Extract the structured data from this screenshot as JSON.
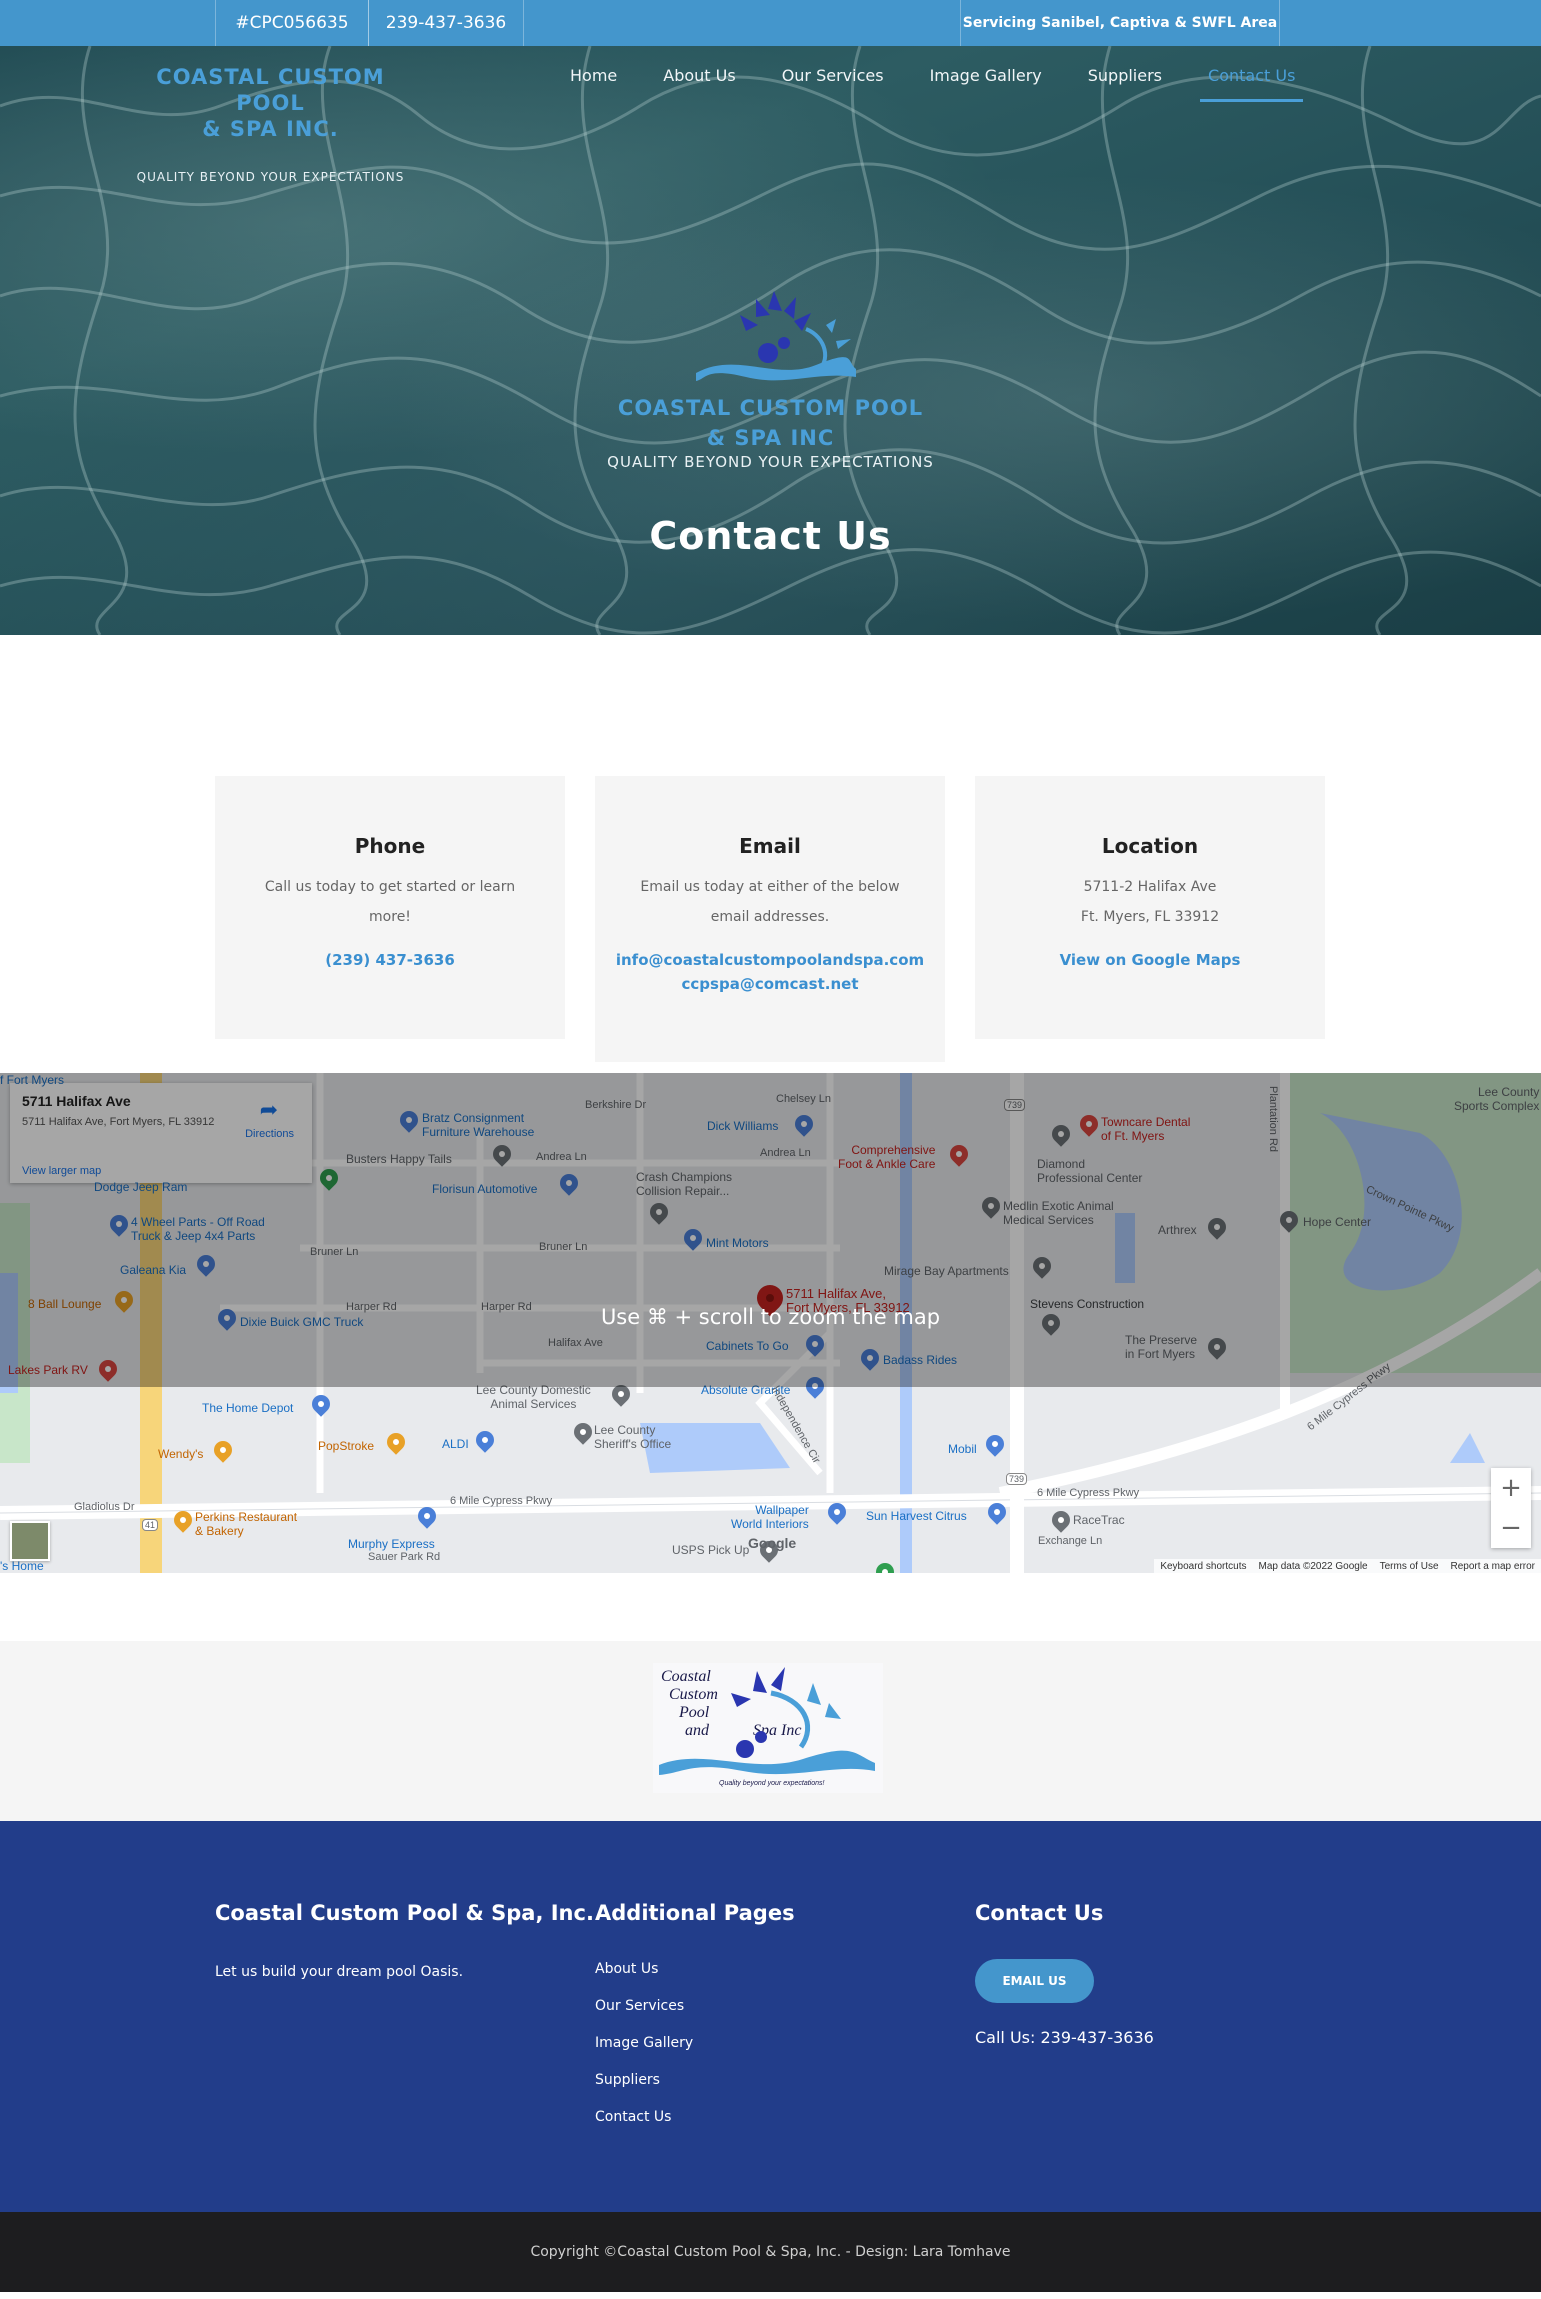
{
  "topbar": {
    "license": "#CPC056635",
    "phone": "239-437-3636",
    "service_area": "Servicing Sanibel, Captiva & SWFL Area"
  },
  "brand": {
    "name_line1": "COASTAL CUSTOM POOL",
    "name_line2": "& SPA INC.",
    "tagline": "QUALITY BEYOND YOUR EXPECTATIONS"
  },
  "nav": {
    "items": [
      {
        "label": "Home"
      },
      {
        "label": "About Us"
      },
      {
        "label": "Our Services"
      },
      {
        "label": "Image Gallery"
      },
      {
        "label": "Suppliers"
      },
      {
        "label": "Contact Us",
        "active": true
      }
    ]
  },
  "hero": {
    "logo_line1": "COASTAL CUSTOM POOL",
    "logo_line2": "& SPA INC",
    "logo_tagline": "QUALITY BEYOND YOUR EXPECTATIONS",
    "title": "Contact Us"
  },
  "cards": {
    "phone": {
      "title": "Phone",
      "text": "Call us today to get started or learn more!",
      "link": "(239) 437-3636"
    },
    "email": {
      "title": "Email",
      "text": "Email us today at either of the below email addresses.",
      "link1": "info@coastalcustompoolandspa.com",
      "link2": "ccpspa@comcast.net"
    },
    "location": {
      "title": "Location",
      "line1": "5711-2 Halifax Ave",
      "line2": "Ft. Myers, FL 33912",
      "link": "View on Google Maps"
    }
  },
  "map": {
    "zoom_hint": "Use ⌘ + scroll to zoom the map",
    "infobox": {
      "title": "5711 Halifax Ave",
      "address": "5711 Halifax Ave, Fort Myers, FL 33912",
      "directions": "Directions",
      "view_larger": "View larger map"
    },
    "marker_label_line1": "5711 Halifax Ave,",
    "marker_label_line2": "Fort Myers, FL 33912",
    "places": {
      "bratz": "Bratz Consignment",
      "bratz2": "Furniture Warehouse",
      "dick": "Dick Williams",
      "comp1": "Comprehensive",
      "comp2": "Foot & Ankle Care",
      "town1": "Towncare Dental",
      "town2": "of Ft. Myers",
      "lee1": "Lee County",
      "lee2": "Sports Complex",
      "busters": "Busters Happy Tails",
      "dodge": "Dodge Jeep Ram",
      "florisun": "Florisun Automotive",
      "crash1": "Crash Champions",
      "crash2": "Collision Repair...",
      "diamond1": "Diamond",
      "diamond2": "Professional Center",
      "medlin1": "Medlin Exotic Animal",
      "medlin2": "Medical Services",
      "arthrex": "Arthrex",
      "hope": "Hope Center",
      "wheel1": "4 Wheel Parts - Off Road",
      "wheel2": "Truck & Jeep 4x4 Parts",
      "mint": "Mint Motors",
      "galeana": "Galeana Kia",
      "mirage": "Mirage Bay Apartments",
      "stevens": "Stevens Construction",
      "ball": "8 Ball Lounge",
      "dixie": "Dixie Buick GMC Truck",
      "cabinets": "Cabinets To Go",
      "badass": "Badass Rides",
      "preserve1": "The Preserve",
      "preserve2": "in Fort Myers",
      "lakes": "Lakes Park RV",
      "leedom1": "Lee County Domestic",
      "leedom2": "Animal Services",
      "absolute": "Absolute Granite",
      "homedepot": "The Home Depot",
      "sheriff1": "Lee County",
      "sheriff2": "Sheriff's Office",
      "wendys": "Wendy's",
      "popstroke": "PopStroke",
      "aldi": "ALDI",
      "mobil": "Mobil",
      "perkins1": "Perkins Restaurant",
      "perkins2": "& Bakery",
      "murphy": "Murphy Express",
      "wallpaper1": "Wallpaper",
      "wallpaper2": "World Interiors",
      "sunharvest": "Sun Harvest Citrus",
      "racetrac": "RaceTrac",
      "usps": "USPS Pick Up",
      "road_andrea1": "Andrea Ln",
      "road_andrea2": "Andrea Ln",
      "road_bruner1": "Bruner Ln",
      "road_bruner2": "Bruner Ln",
      "road_harper1": "Harper Rd",
      "road_harper2": "Harper Rd",
      "road_halifax": "Halifax Ave",
      "road_chelsey": "Chelsey Ln",
      "road_berkshire": "Berkshire Dr",
      "road_gladiolus": "Gladiolus Dr",
      "road_sixmile1": "6 Mile Cypress Pkwy",
      "road_sixmile2": "6 Mile Cypress Pkwy",
      "road_sixmile3": "6 Mile Cypress Pkwy",
      "road_sauer": "Sauer Park Rd",
      "road_exchange": "Exchange Ln",
      "road_crown": "Crown Pointe Pkwy",
      "road_indep": "Independence Cir",
      "road_plant": "Plantation Rd",
      "fort_myers": "f Fort Myers",
      "home_partial": "'s Home",
      "shield_739a": "739",
      "shield_739b": "739",
      "shield_41": "41",
      "google": "Google"
    },
    "attribution": [
      "Keyboard shortcuts",
      "Map data ©2022 Google",
      "Terms of Use",
      "Report a map error"
    ],
    "zoom_in": "+",
    "zoom_out": "−"
  },
  "logo_band": {
    "line1": "Coastal",
    "line2": "Custom",
    "line3": "Pool",
    "line4": "and",
    "line5": "Spa Inc",
    "tagline": "Quality beyond your expectations!"
  },
  "footer": {
    "col1_title": "Coastal Custom Pool & Spa, Inc.",
    "col1_text": "Let us build your dream pool Oasis.",
    "col2_title": "Additional Pages",
    "links": [
      "About Us",
      "Our Services",
      "Image Gallery",
      "Suppliers",
      "Contact Us"
    ],
    "col3_title": "Contact Us",
    "email_button": "EMAIL US",
    "call": "Call Us: 239-437-3636"
  },
  "copyright": "Copyright ©Coastal Custom Pool & Spa, Inc. - Design: Lara Tomhave",
  "colors": {
    "accent": "#4496cc",
    "footer_bg": "#223d8a",
    "copyright_bg": "#1d1d1f"
  }
}
